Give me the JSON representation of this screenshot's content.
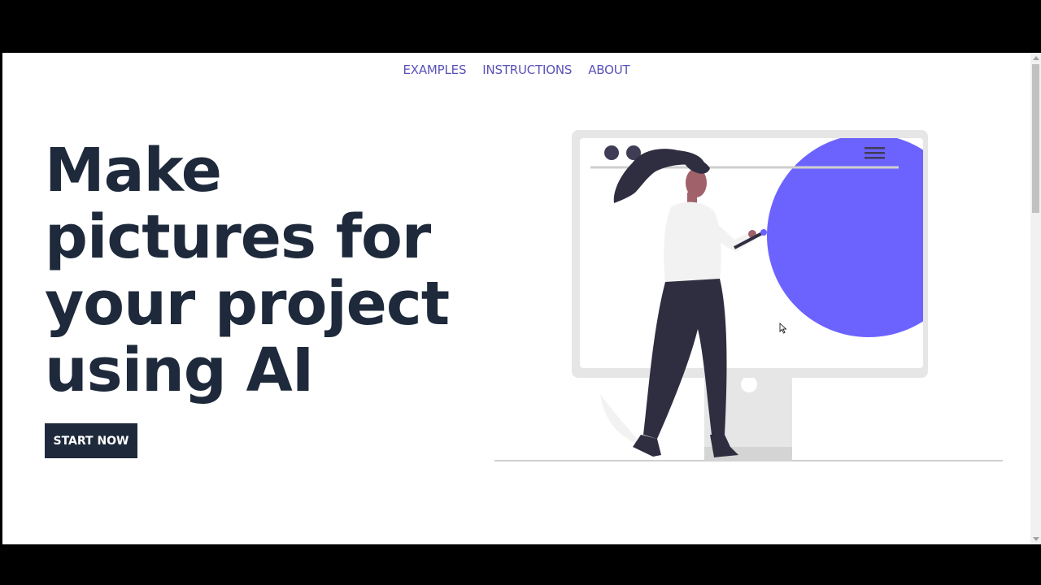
{
  "nav": {
    "items": [
      "EXAMPLES",
      "INSTRUCTIONS",
      "ABOUT"
    ]
  },
  "hero": {
    "title_lines": [
      "Make",
      "pictures for",
      "your project",
      "using AI"
    ],
    "cta_label": "START NOW"
  },
  "colors": {
    "brand_dark": "#1e2a3b",
    "accent": "#6c63ff",
    "nav_link": "#5a52b8"
  },
  "illustration": {
    "description_icon": "woman-painting-monitor-illustration"
  }
}
